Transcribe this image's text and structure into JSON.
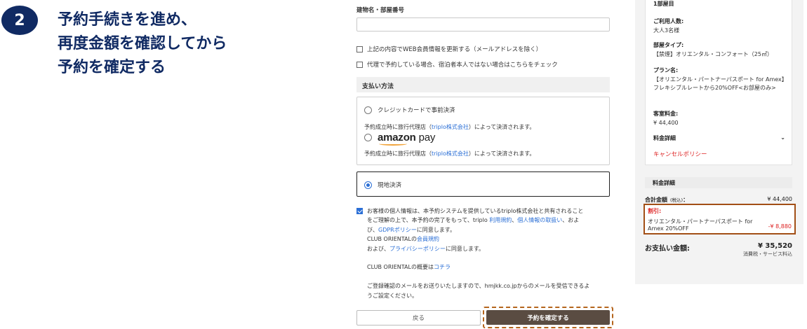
{
  "step": {
    "number": "2",
    "lines": [
      "予約手続きを進め、",
      "再度金額を確認してから",
      "予約を確定する"
    ]
  },
  "form": {
    "building_label": "建物名・部屋番号",
    "building_value": "",
    "checkbox_update_member": "上記の内容でWEB会員情報を更新する（メールアドレスを除く）",
    "checkbox_proxy": "代理で予約している場合、宿泊者本人ではない場合はこちらをチェック",
    "payment_heading": "支払い方法",
    "payment_options": {
      "credit": "クレジットカードで事前決済",
      "note_prefix": "予約成立時に旅行代理店（",
      "note_link": "triplo株式会社",
      "note_suffix": "）によって決済されます。",
      "amazon_word": "amazon",
      "amazon_pay": "pay",
      "onsite": "現地決済"
    },
    "consent": {
      "line1": "お客様の個人情報は、本予約システムを提供しているtriplo株式会社と共有されること",
      "line2a": "をご理解の上で、本予約の完了をもって、triplo ",
      "line2_link1": "利用規約",
      "line2_sep": "、",
      "line2_link2": "個人情報の取扱い",
      "line2b": "、およ",
      "line3a": "び、",
      "line3_link": "GDPRポリシー",
      "line3b": "に同意します。",
      "line4a": "CLUB ORIENTALの",
      "line4_link": "会員規約",
      "line5a": "および、",
      "line5_link": "プライバシーポリシー",
      "line5b": "に同意します。",
      "line6a": "CLUB ORIENTALの概要は",
      "line6_link": "コチラ",
      "line7": "ご登録確認のメールをお送りいたしますので、hmjkk.co.jpからのメールを受信できるよ",
      "line8": "うご設定ください。"
    },
    "back_button": "戻る",
    "confirm_button": "予約を確定する"
  },
  "summary": {
    "rooms_label": "1部屋目",
    "guests_label": "ご利用人数:",
    "guests_value": "大人3名様",
    "room_type_label": "部屋タイプ:",
    "room_type_value": "【禁煙】オリエンタル・コンフォート（25㎡）",
    "plan_label": "プラン名:",
    "plan_value": "【オリエンタル・パートナーパスポート for Amex】フレキシブルレートから20%OFF<お部屋のみ>",
    "room_charge_label": "客室料金:",
    "room_charge_value": "¥ 44,400",
    "fee_detail_label": "料金詳細",
    "cancel_policy": "キャンセルポリシー",
    "fee_section_heading": "料金詳細",
    "total_label": "合計金額",
    "total_tax": "(税込)",
    "total_colon": "：",
    "total_value": "¥ 44,400",
    "discount_label": "割引:",
    "discount_name": "オリエンタル・パートナーパスポート for Amex 20%OFF",
    "discount_value": "-¥ 8,880",
    "payment_amount_label": "お支払い金額:",
    "payment_amount_value": "¥ 35,520",
    "payment_amount_note": "消費税・サービス料込"
  },
  "colors": {
    "step_navy": "#102a63",
    "link_blue": "#2b6fd6",
    "discount_red": "#dd2222",
    "confirm_button_bg": "#5a4c42",
    "highlight_border": "#a24f16"
  }
}
